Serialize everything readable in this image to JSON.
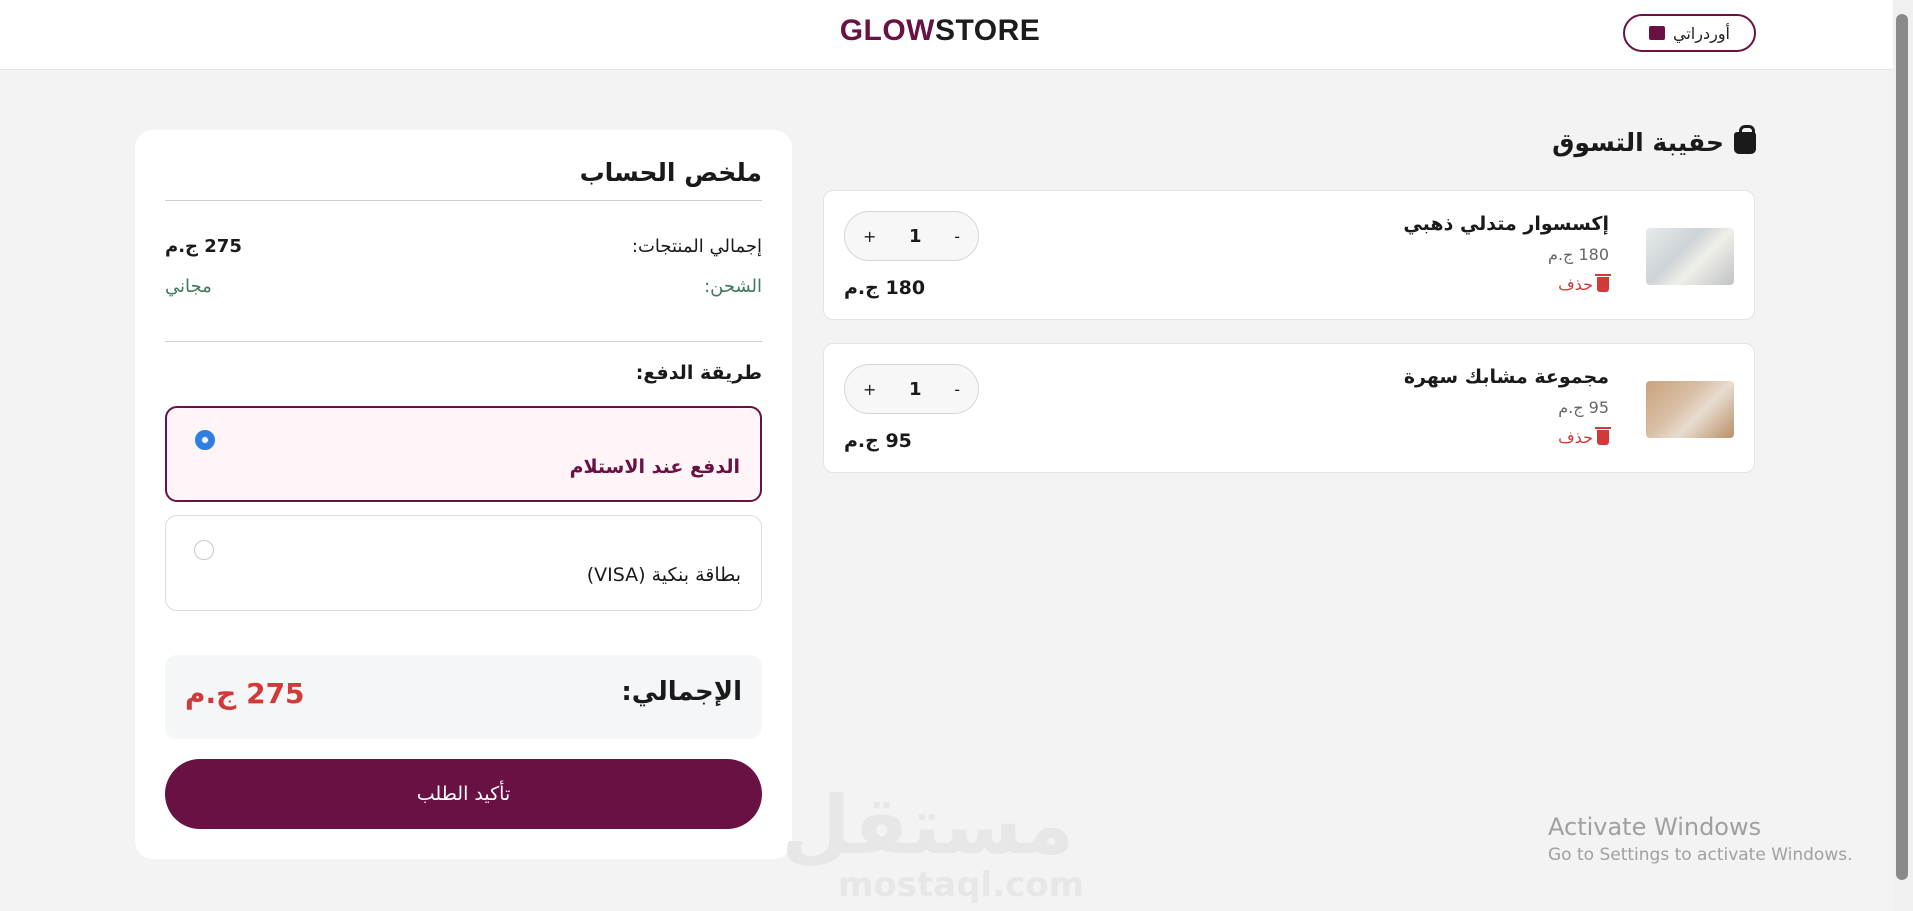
{
  "header": {
    "logo_part1": "GLOW",
    "logo_part2": "STORE",
    "orders_label": "أوردراتي",
    "orders_icon": "box-icon"
  },
  "summary": {
    "title": "ملخص الحساب",
    "subtotal_label": "إجمالي المنتجات:",
    "subtotal_value": "275 ج.م",
    "shipping_label": "الشحن:",
    "shipping_value": "مجاني",
    "payment_title": "طريقة الدفع:",
    "payment_options": [
      {
        "label": "الدفع عند الاستلام",
        "selected": true
      },
      {
        "label": "بطاقة بنكية (VISA)",
        "selected": false
      }
    ],
    "total_label": "الإجمالي:",
    "total_value": "275 ج.م",
    "confirm_label": "تأكيد الطلب"
  },
  "cart": {
    "title": "حقيبة التسوق",
    "title_icon": "shopping-bag-icon",
    "items": [
      {
        "name": "إكسسوار متدلي ذهبي",
        "price": "180 ج.م",
        "delete_label": "حذف",
        "qty": "1",
        "line_total": "180 ج.م",
        "minus": "-",
        "plus": "+"
      },
      {
        "name": "مجموعة مشابك سهرة",
        "price": "95 ج.م",
        "delete_label": "حذف",
        "qty": "1",
        "line_total": "95 ج.م",
        "minus": "-",
        "plus": "+"
      }
    ]
  },
  "watermark": {
    "arabic": "مستقل",
    "latin": "mostaql.com"
  },
  "os_notice": {
    "line1": "Activate Windows",
    "line2": "Go to Settings to activate Windows."
  },
  "colors": {
    "brand": "#6a1144",
    "danger": "#d23a3a",
    "radio": "#2f7fe0",
    "free_shipping": "#3e7a5d"
  }
}
